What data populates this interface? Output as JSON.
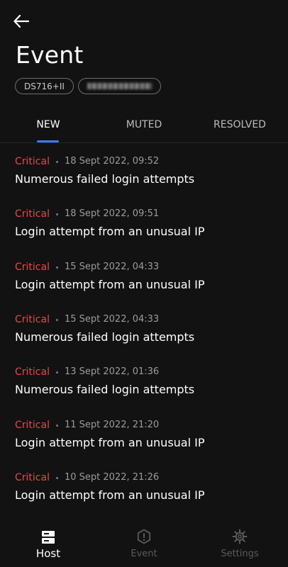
{
  "header": {
    "back_icon": "arrow-left-icon",
    "title": "Event",
    "device_chip": "DS716+II",
    "masked_chip_note": "obscured"
  },
  "tabs": [
    {
      "label": "NEW",
      "active": true
    },
    {
      "label": "MUTED",
      "active": false
    },
    {
      "label": "RESOLVED",
      "active": false
    }
  ],
  "events": [
    {
      "severity": "Critical",
      "time": "18 Sept 2022, 09:52",
      "title": "Numerous failed login attempts"
    },
    {
      "severity": "Critical",
      "time": "18 Sept 2022, 09:51",
      "title": "Login attempt from an unusual IP"
    },
    {
      "severity": "Critical",
      "time": "15 Sept 2022, 04:33",
      "title": "Login attempt from an unusual IP"
    },
    {
      "severity": "Critical",
      "time": "15 Sept 2022, 04:33",
      "title": "Numerous failed login attempts"
    },
    {
      "severity": "Critical",
      "time": "13 Sept 2022, 01:36",
      "title": "Numerous failed login attempts"
    },
    {
      "severity": "Critical",
      "time": "11 Sept 2022, 21:20",
      "title": "Login attempt from an unusual IP"
    },
    {
      "severity": "Critical",
      "time": "10 Sept 2022, 21:26",
      "title": "Login attempt from an unusual IP"
    }
  ],
  "bottom_nav": [
    {
      "label": "Host",
      "icon": "server-icon",
      "active": true
    },
    {
      "label": "Event",
      "icon": "alert-icon",
      "active": false
    },
    {
      "label": "Settings",
      "icon": "gear-icon",
      "active": false
    }
  ],
  "colors": {
    "background": "#121212",
    "accent": "#3f7cf0",
    "critical": "#e8474a"
  }
}
